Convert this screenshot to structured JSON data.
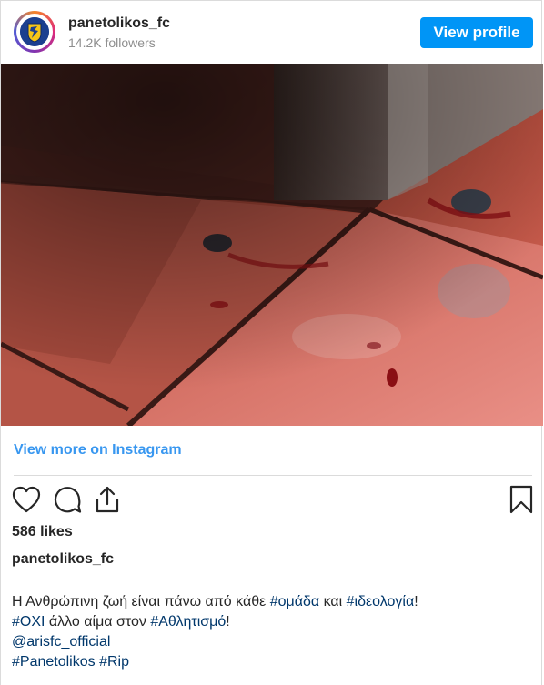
{
  "header": {
    "username": "panetolikos_fc",
    "followers": "14.2K followers",
    "view_profile_label": "View profile"
  },
  "post": {
    "view_more_label": "View more on Instagram",
    "likes": "586 likes",
    "caption_username": "panetolikos_fc",
    "caption_lines": [
      "Η Ανθρώπινη ζωή είναι πάνω από κάθε #ομάδα και #ιδεολογία!",
      "#ΟΧΙ άλλο αίμα στον #Αθλητισμό!",
      "@arisfc_official",
      "#Panetolikos #Rip"
    ]
  },
  "icons": [
    "heart-icon",
    "comment-icon",
    "share-icon",
    "bookmark-icon"
  ],
  "colors": {
    "accent": "#0095f6",
    "link": "#3897f0",
    "hashtag": "#00376b"
  }
}
